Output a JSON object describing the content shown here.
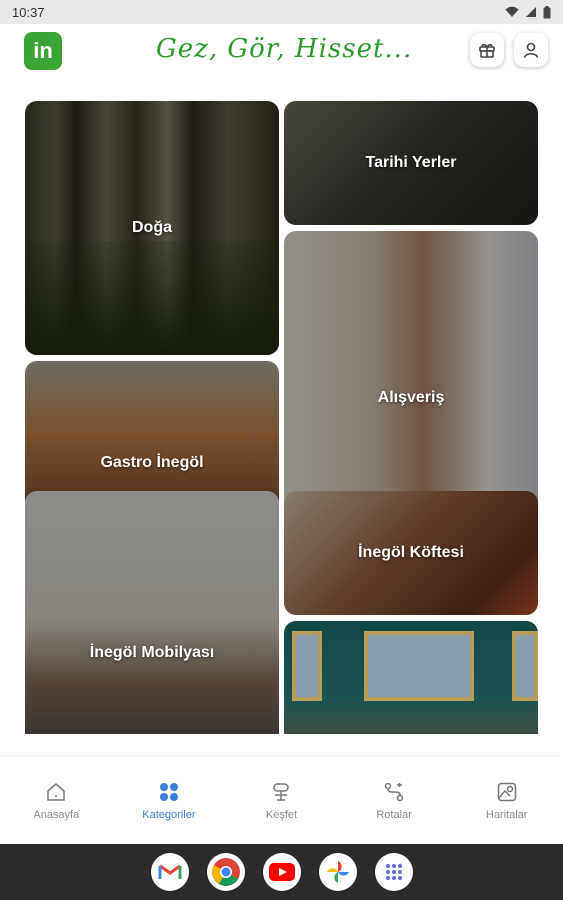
{
  "status_bar": {
    "time": "10:37"
  },
  "header": {
    "logo_text": "in",
    "slogan": "Gez, Gör, Hisset..."
  },
  "categories": [
    {
      "id": "doga",
      "label": "Doğa"
    },
    {
      "id": "tarihi",
      "label": "Tarihi Yerler"
    },
    {
      "id": "alisveris",
      "label": "Alışveriş"
    },
    {
      "id": "gastro",
      "label": "Gastro İnegöl"
    },
    {
      "id": "mobilya",
      "label": "İnegöl Mobilyası"
    },
    {
      "id": "kofte",
      "label": "İnegöl Köftesi"
    },
    {
      "id": "muze",
      "label": ""
    }
  ],
  "nav": {
    "items": [
      {
        "label": "Anasayfa",
        "icon": "home-icon",
        "active": false
      },
      {
        "label": "Kategoriler",
        "icon": "grid-icon",
        "active": true
      },
      {
        "label": "Keşfet",
        "icon": "discover-icon",
        "active": false
      },
      {
        "label": "Rotalar",
        "icon": "route-icon",
        "active": false
      },
      {
        "label": "Haritalar",
        "icon": "map-icon",
        "active": false
      }
    ],
    "active_color": "#3d7fd9"
  },
  "dock": {
    "apps": [
      "gmail-icon",
      "chrome-icon",
      "youtube-icon",
      "photos-icon",
      "app-drawer-icon"
    ]
  },
  "colors": {
    "brand_green": "#3aa535",
    "slogan_green": "#2e9a2e"
  }
}
